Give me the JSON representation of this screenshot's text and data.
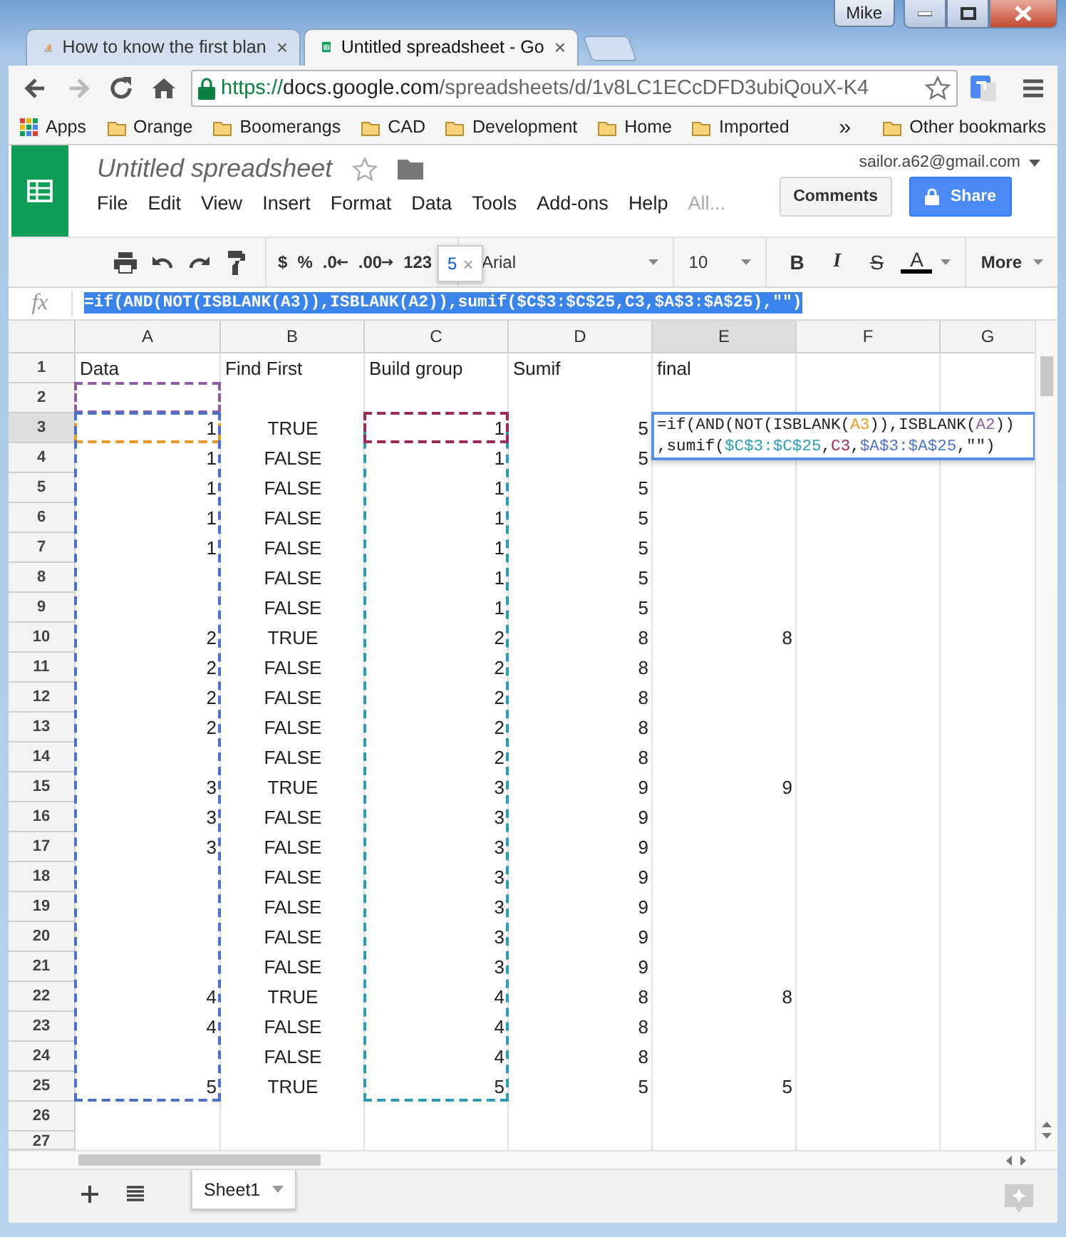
{
  "browser": {
    "user": "Mike",
    "tabs": [
      {
        "title": "How to know the first blan",
        "kind": "stack",
        "selected": false
      },
      {
        "title": "Untitled spreadsheet - Go",
        "kind": "sheets",
        "selected": true
      }
    ],
    "url": {
      "scheme": "https://",
      "host": "docs.google.com",
      "path": "/spreadsheets/d/1v8LC1ECcDFD3ubiQouX-K4"
    },
    "bookmarks": [
      "Apps",
      "Orange",
      "Boomerangs",
      "CAD",
      "Development",
      "Home",
      "Imported"
    ],
    "more_bookmarks": "»",
    "other_bookmarks": "Other bookmarks"
  },
  "doc": {
    "title": "Untitled spreadsheet",
    "account": "sailor.a62@gmail.com",
    "menus": [
      "File",
      "Edit",
      "View",
      "Insert",
      "Format",
      "Data",
      "Tools",
      "Add-ons",
      "Help"
    ],
    "menu_more": "All...",
    "comments": "Comments",
    "share": "Share"
  },
  "toolbar": {
    "format_buttons": [
      "$",
      "%",
      ".0",
      ".00",
      "123"
    ],
    "font": "Arial",
    "size": "10",
    "style_buttons": [
      {
        "label": "B",
        "kind": "bold"
      },
      {
        "label": "I",
        "kind": "italic"
      },
      {
        "label": "S",
        "kind": "strike"
      },
      {
        "label": "A",
        "kind": "color"
      }
    ],
    "more": "More"
  },
  "tooltip": {
    "value": "5",
    "close": "×"
  },
  "formula_bar": {
    "label": "fx",
    "formula": "=if(AND(NOT(ISBLANK(A3)),ISBLANK(A2)),sumif($C$3:$C$25,C3,$A$3:$A$25),\"\")",
    "selected": true
  },
  "columns": [
    {
      "letter": "A",
      "kind": "number",
      "selected": false
    },
    {
      "letter": "B",
      "kind": "boolean",
      "selected": false
    },
    {
      "letter": "C",
      "kind": "number",
      "selected": false
    },
    {
      "letter": "D",
      "kind": "number",
      "selected": false
    },
    {
      "letter": "E",
      "kind": "number",
      "selected": true
    },
    {
      "letter": "F",
      "kind": "number",
      "selected": false
    },
    {
      "letter": "G",
      "kind": "number",
      "selected": false
    }
  ],
  "row_headers": [
    "1",
    "2",
    "3",
    "4",
    "5",
    "6",
    "7",
    "8",
    "9",
    "10",
    "11",
    "12",
    "13",
    "14",
    "15",
    "16",
    "17",
    "18",
    "19",
    "20",
    "21",
    "22",
    "23",
    "24",
    "25",
    "26",
    "27"
  ],
  "rows": [
    {
      "kind": "labels",
      "selected": false,
      "A": "Data",
      "B": "Find First",
      "C": "Build group",
      "D": "Sumif",
      "E": "final"
    },
    {
      "kind": "values",
      "selected": false
    },
    {
      "kind": "values",
      "selected": true,
      "A": "1",
      "B": "TRUE",
      "C": "1",
      "D": "5"
    },
    {
      "kind": "values",
      "selected": false,
      "A": "1",
      "B": "FALSE",
      "C": "1",
      "D": "5"
    },
    {
      "kind": "values",
      "selected": false,
      "A": "1",
      "B": "FALSE",
      "C": "1",
      "D": "5"
    },
    {
      "kind": "values",
      "selected": false,
      "A": "1",
      "B": "FALSE",
      "C": "1",
      "D": "5"
    },
    {
      "kind": "values",
      "selected": false,
      "A": "1",
      "B": "FALSE",
      "C": "1",
      "D": "5"
    },
    {
      "kind": "values",
      "selected": false,
      "B": "FALSE",
      "C": "1",
      "D": "5"
    },
    {
      "kind": "values",
      "selected": false,
      "B": "FALSE",
      "C": "1",
      "D": "5"
    },
    {
      "kind": "values",
      "selected": false,
      "A": "2",
      "B": "TRUE",
      "C": "2",
      "D": "8",
      "E": "8"
    },
    {
      "kind": "values",
      "selected": false,
      "A": "2",
      "B": "FALSE",
      "C": "2",
      "D": "8"
    },
    {
      "kind": "values",
      "selected": false,
      "A": "2",
      "B": "FALSE",
      "C": "2",
      "D": "8"
    },
    {
      "kind": "values",
      "selected": false,
      "A": "2",
      "B": "FALSE",
      "C": "2",
      "D": "8"
    },
    {
      "kind": "values",
      "selected": false,
      "B": "FALSE",
      "C": "2",
      "D": "8"
    },
    {
      "kind": "values",
      "selected": false,
      "A": "3",
      "B": "TRUE",
      "C": "3",
      "D": "9",
      "E": "9"
    },
    {
      "kind": "values",
      "selected": false,
      "A": "3",
      "B": "FALSE",
      "C": "3",
      "D": "9"
    },
    {
      "kind": "values",
      "selected": false,
      "A": "3",
      "B": "FALSE",
      "C": "3",
      "D": "9"
    },
    {
      "kind": "values",
      "selected": false,
      "B": "FALSE",
      "C": "3",
      "D": "9"
    },
    {
      "kind": "values",
      "selected": false,
      "B": "FALSE",
      "C": "3",
      "D": "9"
    },
    {
      "kind": "values",
      "selected": false,
      "B": "FALSE",
      "C": "3",
      "D": "9"
    },
    {
      "kind": "values",
      "selected": false,
      "B": "FALSE",
      "C": "3",
      "D": "9"
    },
    {
      "kind": "values",
      "selected": false,
      "A": "4",
      "B": "TRUE",
      "C": "4",
      "D": "8",
      "E": "8"
    },
    {
      "kind": "values",
      "selected": false,
      "A": "4",
      "B": "FALSE",
      "C": "4",
      "D": "8"
    },
    {
      "kind": "values",
      "selected": false,
      "B": "FALSE",
      "C": "4",
      "D": "8"
    },
    {
      "kind": "values",
      "selected": false,
      "A": "5",
      "B": "TRUE",
      "C": "5",
      "D": "5",
      "E": "5"
    },
    {
      "kind": "values",
      "selected": false
    },
    {
      "kind": "values",
      "selected": false
    }
  ],
  "cell_editor": {
    "lines": [
      [
        {
          "text": "=if(AND(NOT(ISBLANK("
        },
        {
          "text": "A3",
          "color": "#e69a28"
        },
        {
          "text": ")),ISBLANK("
        },
        {
          "text": "A2",
          "color": "#8e5ea2"
        },
        {
          "text": "))"
        }
      ],
      [
        {
          "text": ",sumif("
        },
        {
          "text": "$C$3:$C$25",
          "color": "#2a9db5"
        },
        {
          "text": ","
        },
        {
          "text": "C3",
          "color": "#9c2b5a"
        },
        {
          "text": ","
        },
        {
          "text": "$A$3:$A$25",
          "color": "#4a72c8"
        },
        {
          "text": ",\"\")"
        }
      ]
    ]
  },
  "sheets": [
    {
      "name": "Sheet1",
      "selected": true
    }
  ]
}
